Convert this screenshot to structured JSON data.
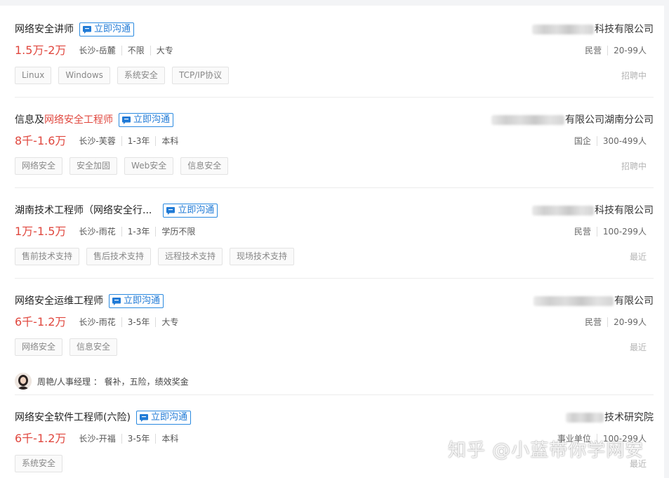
{
  "jobs": [
    {
      "title_pre": "网络安全讲师",
      "title_hl": "",
      "title_post": "",
      "chat_label": "立即沟通",
      "salary": "1.5万-2万",
      "location": "长沙-岳麓",
      "experience": "不限",
      "education": "大专",
      "tags": [
        "Linux",
        "Windows",
        "系统安全",
        "TCP/IP协议"
      ],
      "company_suffix": "科技有限公司",
      "company_type": "民营",
      "company_size": "20-99人",
      "status": "招聘中"
    },
    {
      "title_pre": "信息及",
      "title_hl": "网络安全工程师",
      "title_post": "",
      "chat_label": "立即沟通",
      "salary": "8千-1.6万",
      "location": "长沙-芙蓉",
      "experience": "1-3年",
      "education": "本科",
      "tags": [
        "网络安全",
        "安全加固",
        "Web安全",
        "信息安全"
      ],
      "company_suffix": "有限公司湖南分公司",
      "company_type": "国企",
      "company_size": "300-499人",
      "status": "招聘中"
    },
    {
      "title_pre": "湖南技术工程师（网络安全行...",
      "title_hl": "",
      "title_post": "",
      "chat_label": "立即沟通",
      "salary": "1万-1.5万",
      "location": "长沙-雨花",
      "experience": "1-3年",
      "education": "学历不限",
      "tags": [
        "售前技术支持",
        "售后技术支持",
        "远程技术支持",
        "现场技术支持"
      ],
      "company_suffix": "科技有限公司",
      "company_type": "民营",
      "company_size": "100-299人",
      "status": "最近"
    },
    {
      "title_pre": "网络安全运维工程师",
      "title_hl": "",
      "title_post": "",
      "chat_label": "立即沟通",
      "salary": "6千-1.2万",
      "location": "长沙-雨花",
      "experience": "3-5年",
      "education": "大专",
      "tags": [
        "网络安全",
        "信息安全"
      ],
      "company_suffix": "有限公司",
      "company_type": "民营",
      "company_size": "20-99人",
      "status": "最近",
      "hr_text": "周艳/人事经理 ： 餐补，五险，绩效奖金"
    },
    {
      "title_pre": "网络安全软件工程师(六险)",
      "title_hl": "",
      "title_post": "",
      "chat_label": "立即沟通",
      "salary": "6千-1.2万",
      "location": "长沙-开福",
      "experience": "3-5年",
      "education": "本科",
      "tags": [
        "系统安全"
      ],
      "company_suffix": "技术研究院",
      "company_type": "事业单位",
      "company_size": "100-299人",
      "status": "最近"
    }
  ],
  "watermark": "知乎 @小蓝带你学网安",
  "colors": {
    "accent_red": "#e0473e",
    "accent_blue": "#1f7ad6"
  }
}
